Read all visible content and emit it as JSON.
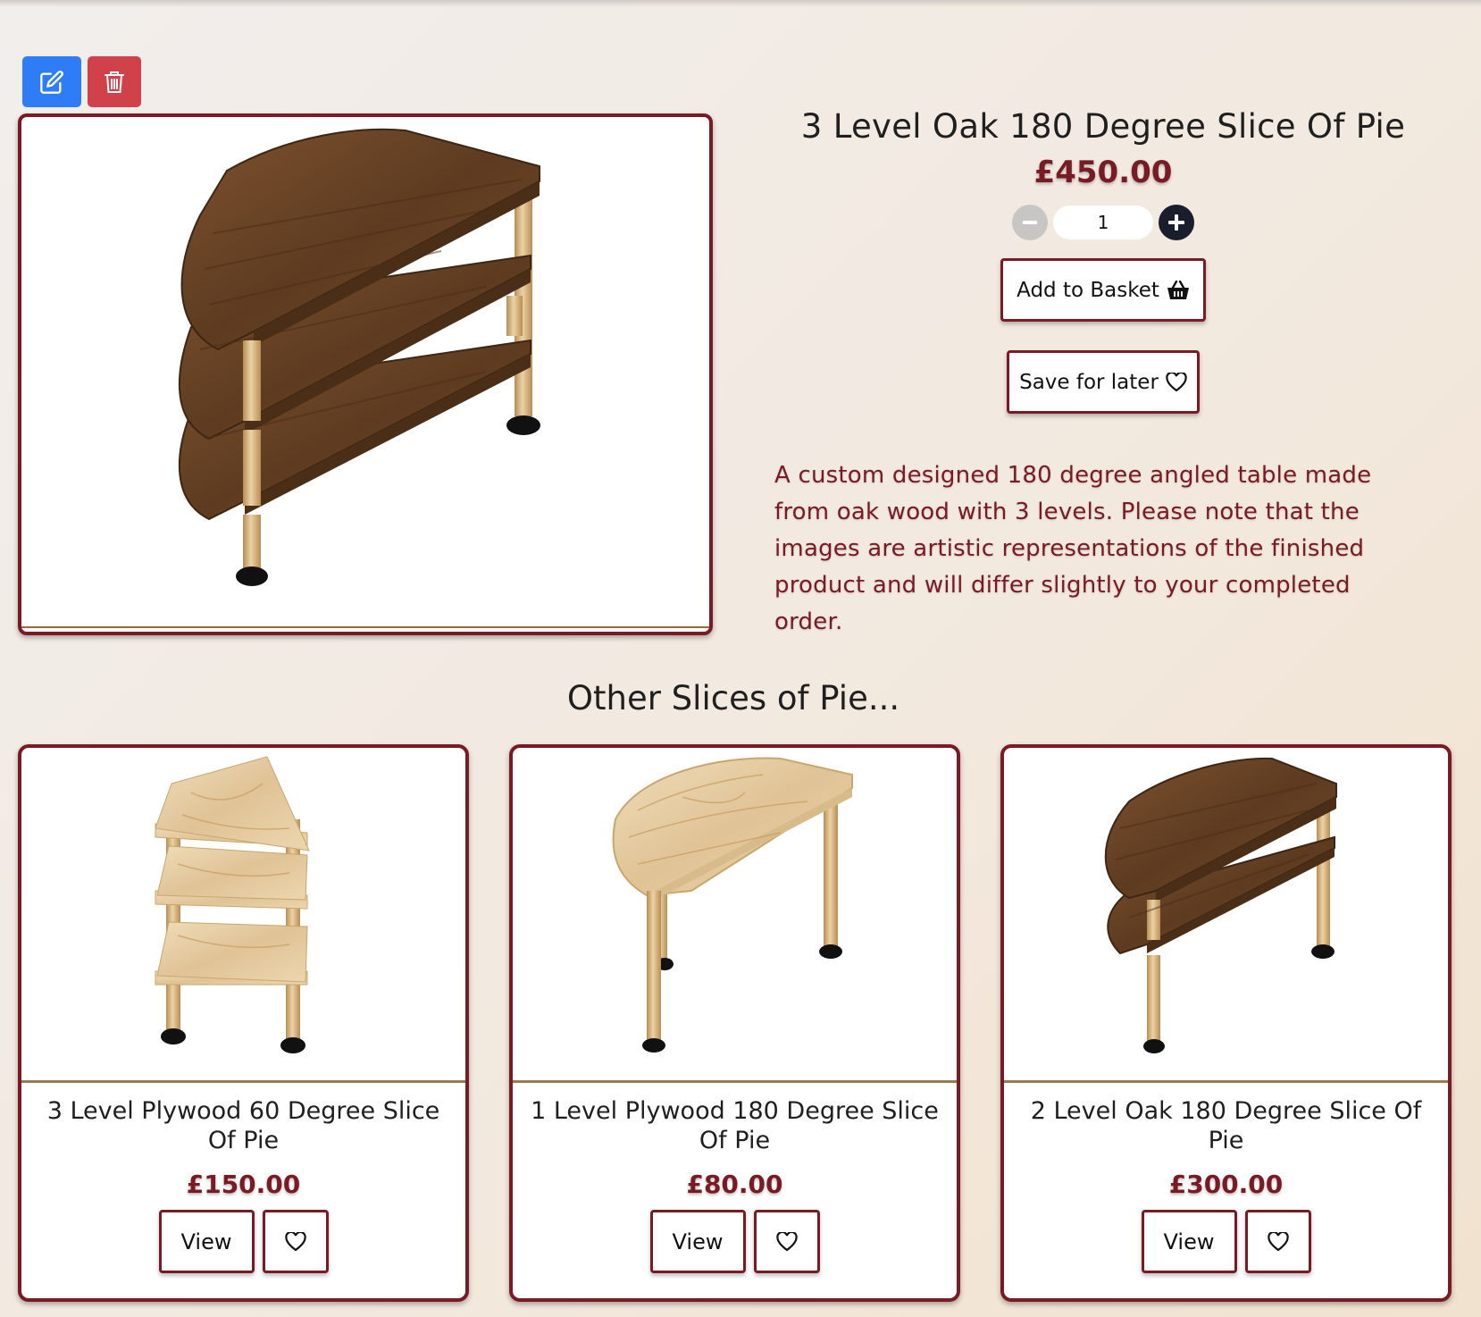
{
  "admin": {
    "edit_icon": "edit-icon",
    "delete_icon": "trash-icon",
    "edit_color": "#2f7df6",
    "delete_color": "#d0414a"
  },
  "product": {
    "title": "3 Level Oak 180 Degree Slice Of Pie",
    "price": "£450.00",
    "quantity": "1",
    "add_to_basket_label": "Add to Basket",
    "save_for_later_label": "Save for later",
    "description": "A custom designed 180 degree angled table made from oak wood with 3 levels. Please note that the images are artistic representations of the finished product and will differ slightly to your completed order."
  },
  "related": {
    "heading": "Other Slices of Pie...",
    "items": [
      {
        "title": "3 Level Plywood 60 Degree Slice Of Pie",
        "price": "£150.00",
        "view_label": "View"
      },
      {
        "title": "1 Level Plywood 180 Degree Slice Of Pie",
        "price": "£80.00",
        "view_label": "View"
      },
      {
        "title": "2 Level Oak 180 Degree Slice Of Pie",
        "price": "£300.00",
        "view_label": "View"
      }
    ]
  },
  "colors": {
    "accent": "#7a1a24",
    "oak": "#6b4426",
    "plywood": "#e4cba0",
    "leg": "#d6b47c"
  }
}
